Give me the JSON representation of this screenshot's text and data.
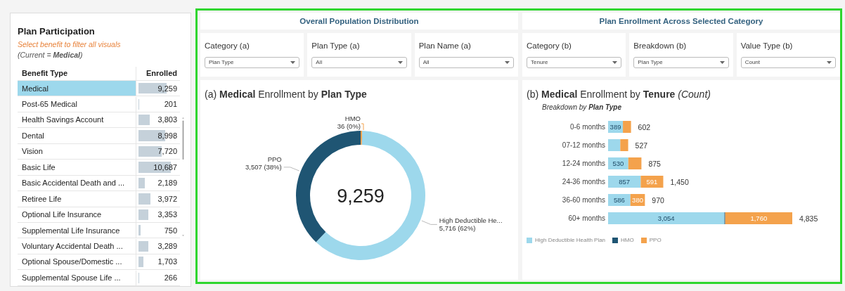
{
  "plan_participation": {
    "title": "Plan Participation",
    "hint": "Select benefit to filter all visuals",
    "current": "(Current = **Medical**)",
    "table": {
      "columns": [
        "Benefit Type",
        "Enrolled"
      ],
      "rows": [
        {
          "name": "Medical",
          "enrolled": "9,259",
          "level": 0.64,
          "selected": true
        },
        {
          "name": "Post-65 Medical",
          "enrolled": "201",
          "level": 0.014,
          "selected": false
        },
        {
          "name": "Health Savings Account",
          "enrolled": "3,803",
          "level": 0.26,
          "selected": false
        },
        {
          "name": "Dental",
          "enrolled": "8,998",
          "level": 0.62,
          "selected": false
        },
        {
          "name": "Vision",
          "enrolled": "7,720",
          "level": 0.53,
          "selected": false
        },
        {
          "name": "Basic Life",
          "enrolled": "10,687",
          "level": 0.74,
          "selected": false
        },
        {
          "name": "Basic Accidental Death and ...",
          "enrolled": "2,189",
          "level": 0.15,
          "selected": false
        },
        {
          "name": "Retiree Life",
          "enrolled": "3,972",
          "level": 0.28,
          "selected": false
        },
        {
          "name": "Optional Life Insurance",
          "enrolled": "3,353",
          "level": 0.23,
          "selected": false
        },
        {
          "name": "Supplemental Life Insurance",
          "enrolled": "750",
          "level": 0.05,
          "selected": false
        },
        {
          "name": "Voluntary Accidental Death ...",
          "enrolled": "3,289",
          "level": 0.23,
          "selected": false
        },
        {
          "name": "Optional Spouse/Domestic ...",
          "enrolled": "1,703",
          "level": 0.12,
          "selected": false
        },
        {
          "name": "Supplemental Spouse Life ...",
          "enrolled": "266",
          "level": 0.02,
          "selected": false
        }
      ]
    }
  },
  "sections": [
    {
      "heading": "Overall Population Distribution",
      "filters": [
        {
          "label": "Category (a)",
          "value": "Plan Type"
        },
        {
          "label": "Plan Type (a)",
          "value": "All"
        },
        {
          "label": "Plan Name (a)",
          "value": "All"
        }
      ],
      "visual": {
        "title": "(a) **Medical** Enrollment by **Plan Type**",
        "total": "9,259",
        "chart_data": {
          "type": "donut",
          "categories": [
            "HMO",
            "High Deductible He...",
            "PPO"
          ],
          "values": [
            36,
            5716,
            3507
          ],
          "colors": [
            "#f4a24c",
            "#9dd8ec",
            "#1f5573"
          ],
          "value_labels": [
            "36 (0%)",
            "5,716 (62%)",
            "3,507 (38%)"
          ]
        }
      }
    },
    {
      "heading": "Plan Enrollment Across Selected Category",
      "filters": [
        {
          "label": "Category (b)",
          "value": "Tenure"
        },
        {
          "label": "Breakdown (b)",
          "value": "Plan Type"
        },
        {
          "label": "Value Type (b)",
          "value": "Count"
        }
      ],
      "visual": {
        "title": "(b) **Medical** Enrollment by **Tenure** *(Count)*",
        "subtitle": "Breakdown by **Plan Type**",
        "chart_data": {
          "type": "bar",
          "orientation": "horizontal",
          "stacked": true,
          "categories": [
            "0-6 months",
            "07-12 months",
            "12-24 months",
            "24-36 months",
            "36-60 months",
            "60+ months"
          ],
          "series": [
            {
              "name": "High Deductible Health Plan",
              "color": "#9dd8ec",
              "values": [
                389,
                320,
                530,
                857,
                586,
                3054
              ],
              "value_labels": [
                "389",
                null,
                "530",
                "857",
                "586",
                "3,054"
              ]
            },
            {
              "name": "HMO",
              "color": "#1f5573",
              "values": [
                null,
                null,
                null,
                null,
                null,
                21
              ],
              "value_labels": [
                null,
                null,
                null,
                null,
                null,
                null
              ]
            },
            {
              "name": "PPO",
              "color": "#f4a24c",
              "values": [
                213,
                207,
                345,
                591,
                380,
                1760
              ],
              "value_labels": [
                null,
                null,
                null,
                "591",
                "380",
                "1,760"
              ]
            }
          ],
          "annotations": [
            "602",
            "527",
            "875",
            "1,450",
            "970",
            "4,835"
          ]
        }
      }
    }
  ]
}
